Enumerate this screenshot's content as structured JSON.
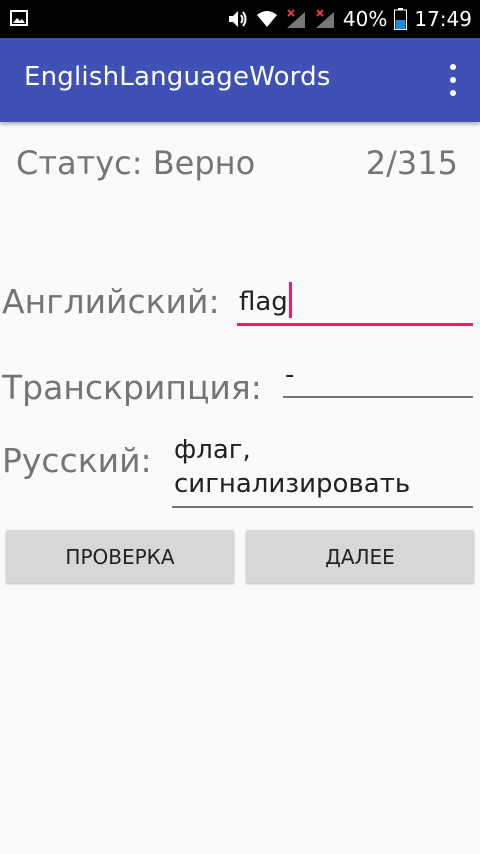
{
  "status_bar": {
    "battery_percent": "40%",
    "time": "17:49",
    "icons": [
      "gallery-icon",
      "volume-icon",
      "wifi-icon",
      "signal-icon-1",
      "signal-icon-2",
      "battery-icon"
    ]
  },
  "app_bar": {
    "title": "EnglishLanguageWords",
    "overflow_icon": "more-vert-icon"
  },
  "main": {
    "status_label": "Статус: Верно",
    "counter": "2/315",
    "english": {
      "label": "Английский:",
      "value": "flag"
    },
    "transcription": {
      "label": "Транскрипция:",
      "value": "-"
    },
    "russian": {
      "label": "Русский:",
      "value_line1": "флаг,",
      "value_line2": "сигнализировать"
    },
    "buttons": {
      "check": "ПРОВЕРКА",
      "next": "ДАЛЕЕ"
    }
  },
  "colors": {
    "app_bar": "#3f51b5",
    "accent": "#e91e63",
    "background": "#fafafa",
    "button": "#d6d7d7"
  }
}
